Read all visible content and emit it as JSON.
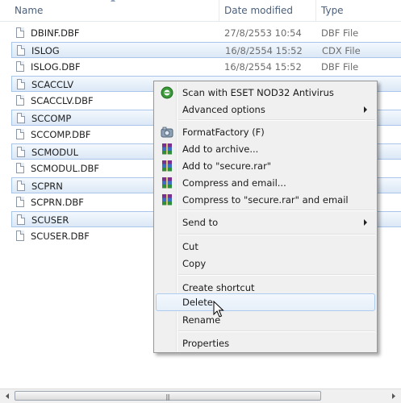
{
  "columns": {
    "name": "Name",
    "date": "Date modified",
    "type": "Type"
  },
  "files": [
    {
      "name": "DBINF.DBF",
      "date": "27/8/2553 10:54",
      "type": "DBF File",
      "selected": false
    },
    {
      "name": "ISLOG",
      "date": "16/8/2554 15:52",
      "type": "CDX File",
      "selected": true
    },
    {
      "name": "ISLOG.DBF",
      "date": "16/8/2554 15:52",
      "type": "DBF File",
      "selected": false
    },
    {
      "name": "SCACCLV",
      "date": "",
      "type": "",
      "selected": true
    },
    {
      "name": "SCACCLV.DBF",
      "date": "",
      "type": "",
      "selected": false
    },
    {
      "name": "SCCOMP",
      "date": "",
      "type": "",
      "selected": true
    },
    {
      "name": "SCCOMP.DBF",
      "date": "",
      "type": "",
      "selected": false
    },
    {
      "name": "SCMODUL",
      "date": "",
      "type": "",
      "selected": true
    },
    {
      "name": "SCMODUL.DBF",
      "date": "",
      "type": "",
      "selected": false
    },
    {
      "name": "SCPRN",
      "date": "",
      "type": "",
      "selected": true
    },
    {
      "name": "SCPRN.DBF",
      "date": "",
      "type": "",
      "selected": false
    },
    {
      "name": "SCUSER",
      "date": "",
      "type": "",
      "selected": true
    },
    {
      "name": "SCUSER.DBF",
      "date": "",
      "type": "",
      "selected": false
    }
  ],
  "context_menu": {
    "items": [
      {
        "label": "Scan with ESET NOD32 Antivirus",
        "icon": "eset-icon"
      },
      {
        "label": "Advanced options",
        "icon": "",
        "submenu": true
      },
      {
        "label": "FormatFactory (F)",
        "icon": "formatfactory-icon"
      },
      {
        "label": "Add to archive...",
        "icon": "winrar-icon"
      },
      {
        "label": "Add to \"secure.rar\"",
        "icon": "winrar-icon"
      },
      {
        "label": "Compress and email...",
        "icon": "winrar-icon"
      },
      {
        "label": "Compress to \"secure.rar\" and email",
        "icon": "winrar-icon"
      },
      {
        "label": "Send to",
        "icon": "",
        "submenu": true
      },
      {
        "label": "Cut",
        "icon": ""
      },
      {
        "label": "Copy",
        "icon": ""
      },
      {
        "label": "Create shortcut",
        "icon": ""
      },
      {
        "label": "Delete",
        "icon": "",
        "highlighted": true
      },
      {
        "label": "Rename",
        "icon": ""
      },
      {
        "label": "Properties",
        "icon": ""
      }
    ]
  },
  "colors": {
    "selection_border": "#a9c6ea",
    "menu_bg": "#f0f0f0",
    "hot_border": "#aeccef"
  }
}
